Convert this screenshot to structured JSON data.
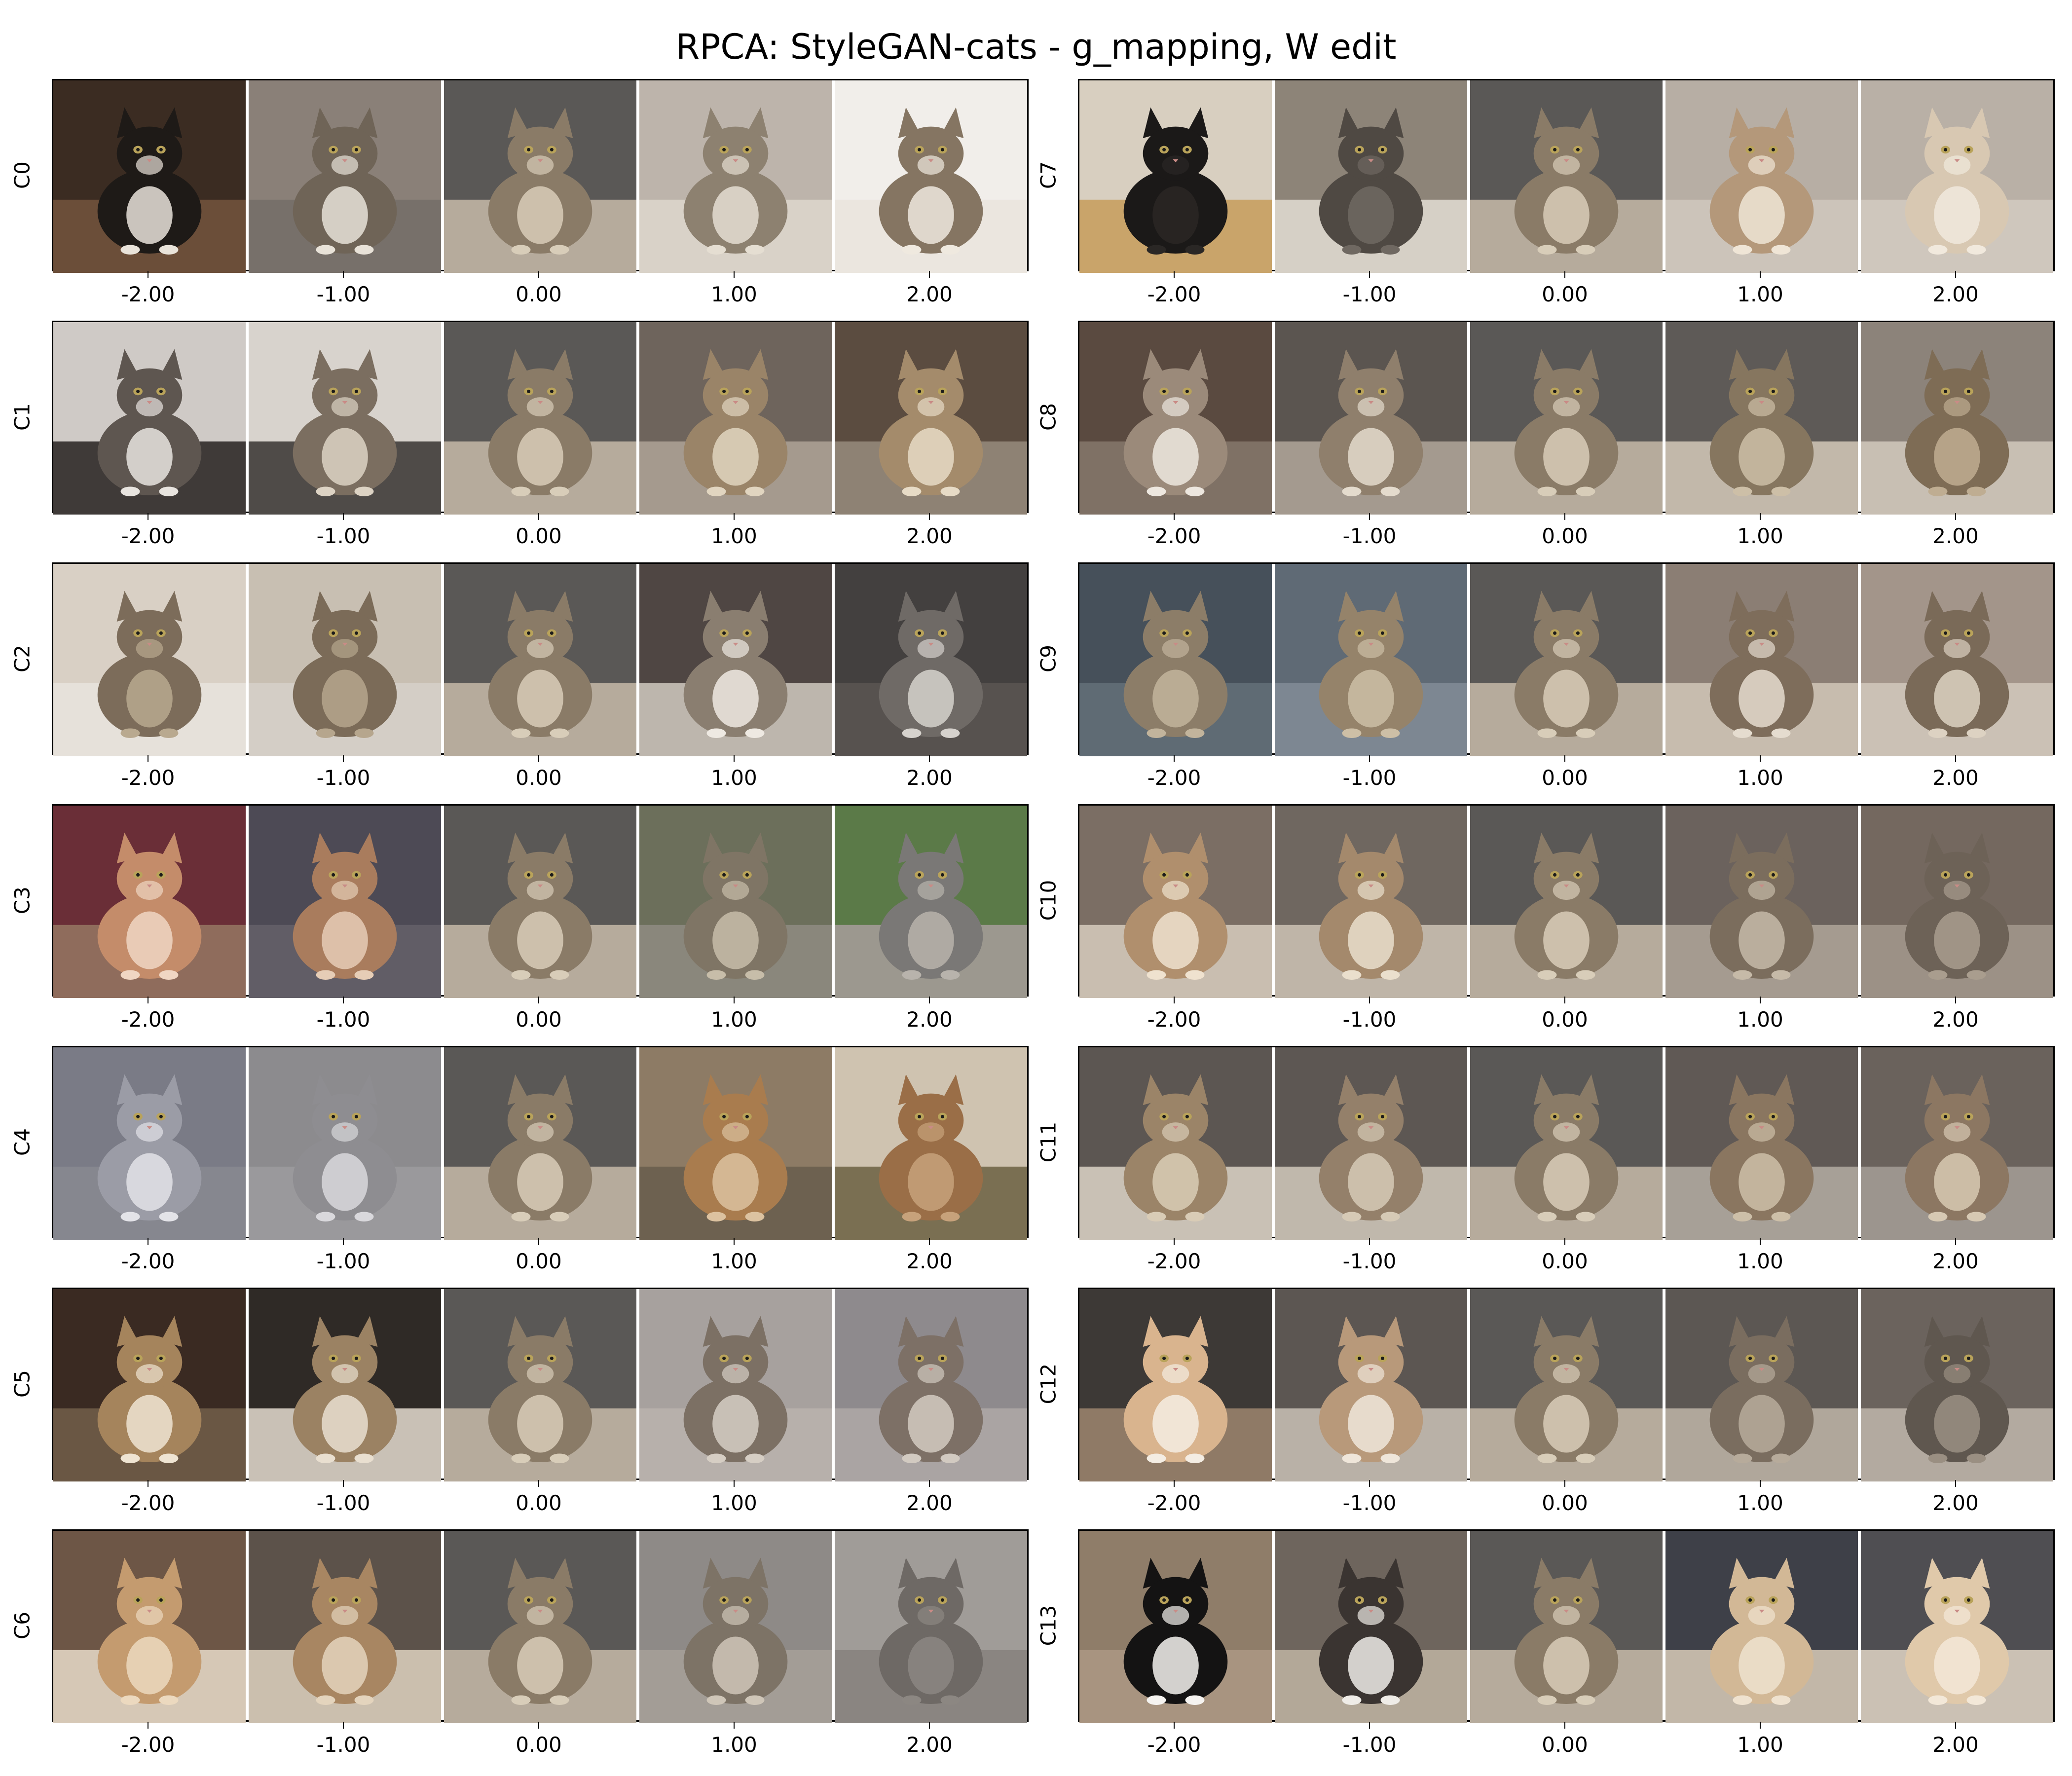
{
  "title": "RPCA: StyleGAN-cats - g_mapping, W edit",
  "x_ticks": [
    "-2.00",
    "-1.00",
    "0.00",
    "1.00",
    "2.00"
  ],
  "columns": [
    {
      "rows": [
        {
          "label": "C0",
          "images": [
            {
              "bg": "#3b2c22",
              "cat": "#1e1a17",
              "belly": "#e9e3da",
              "floor": "#6b4e39"
            },
            {
              "bg": "#8a8078",
              "cat": "#6f6457",
              "belly": "#e8e2d8",
              "floor": "#77706a"
            },
            {
              "bg": "#5a5856",
              "cat": "#8a7b67",
              "belly": "#d8cdb9",
              "floor": "#b6ab9c"
            },
            {
              "bg": "#bdb4ab",
              "cat": "#8d8170",
              "belly": "#e5ded2",
              "floor": "#d9d2c8"
            },
            {
              "bg": "#f1eeea",
              "cat": "#857562",
              "belly": "#efe9df",
              "floor": "#ebe6df"
            }
          ]
        },
        {
          "label": "C1",
          "images": [
            {
              "bg": "#cfcac6",
              "cat": "#5e5650",
              "belly": "#e8e4df",
              "floor": "#3f3a38"
            },
            {
              "bg": "#d8d3cd",
              "cat": "#7b6e60",
              "belly": "#ddd3c4",
              "floor": "#4f4b48"
            },
            {
              "bg": "#5a5856",
              "cat": "#8a7b67",
              "belly": "#d8cdb9",
              "floor": "#b6ab9c"
            },
            {
              "bg": "#6e645c",
              "cat": "#9a8468",
              "belly": "#e1d5c0",
              "floor": "#a59a8e"
            },
            {
              "bg": "#5b4c40",
              "cat": "#a48b6b",
              "belly": "#e7dbc6",
              "floor": "#8e8274"
            }
          ]
        },
        {
          "label": "C2",
          "images": [
            {
              "bg": "#d9d0c5",
              "cat": "#7c6c5a",
              "belly": "#b9a98f",
              "floor": "#e6e1da"
            },
            {
              "bg": "#c8bfb2",
              "cat": "#7b6b58",
              "belly": "#b6a68d",
              "floor": "#d4cec6"
            },
            {
              "bg": "#5a5856",
              "cat": "#8a7b67",
              "belly": "#d8cdb9",
              "floor": "#b6ab9c"
            },
            {
              "bg": "#4f4643",
              "cat": "#8a7e70",
              "belly": "#eee9e2",
              "floor": "#bdb6ad"
            },
            {
              "bg": "#43403f",
              "cat": "#6f6a66",
              "belly": "#d6d2cd",
              "floor": "#57524f"
            }
          ]
        },
        {
          "label": "C3",
          "images": [
            {
              "bg": "#6a2e37",
              "cat": "#c48c6a",
              "belly": "#f0d6c3",
              "floor": "#8f6c5c"
            },
            {
              "bg": "#4d4a55",
              "cat": "#a97c5d",
              "belly": "#e6cdb6",
              "floor": "#615d66"
            },
            {
              "bg": "#5a5856",
              "cat": "#8a7b67",
              "belly": "#d8cdb9",
              "floor": "#b6ab9c"
            },
            {
              "bg": "#6c6f5b",
              "cat": "#7f7565",
              "belly": "#c7bda9",
              "floor": "#8a877c"
            },
            {
              "bg": "#5b7a48",
              "cat": "#7a7876",
              "belly": "#b8b3ac",
              "floor": "#9c988f"
            }
          ]
        },
        {
          "label": "C4",
          "images": [
            {
              "bg": "#7a7b86",
              "cat": "#9b9ca6",
              "belly": "#e3e3e8",
              "floor": "#86878f"
            },
            {
              "bg": "#8c8b8e",
              "cat": "#8e8d91",
              "belly": "#d9d8dc",
              "floor": "#9a999c"
            },
            {
              "bg": "#5a5856",
              "cat": "#8a7b67",
              "belly": "#d8cdb9",
              "floor": "#b6ab9c"
            },
            {
              "bg": "#8d7b65",
              "cat": "#a97c4e",
              "belly": "#dcc2a0",
              "floor": "#6d6150"
            },
            {
              "bg": "#cfc3b0",
              "cat": "#9a6e47",
              "belly": "#c7a27b",
              "floor": "#7a6f52"
            }
          ]
        },
        {
          "label": "C5",
          "images": [
            {
              "bg": "#3a2a22",
              "cat": "#a5845c",
              "belly": "#efe4d2",
              "floor": "#6a5744"
            },
            {
              "bg": "#2f2a26",
              "cat": "#9b8263",
              "belly": "#e9dfd0",
              "floor": "#c9c1b6"
            },
            {
              "bg": "#5a5856",
              "cat": "#8a7b67",
              "belly": "#d8cdb9",
              "floor": "#b6ab9c"
            },
            {
              "bg": "#a7a19e",
              "cat": "#7c7064",
              "belly": "#d6cec4",
              "floor": "#b7b0ab"
            },
            {
              "bg": "#8e8a8d",
              "cat": "#7d7066",
              "belly": "#d2cac1",
              "floor": "#aaa4a3"
            }
          ]
        },
        {
          "label": "C6",
          "images": [
            {
              "bg": "#6d5646",
              "cat": "#c49b6f",
              "belly": "#ecd9bf",
              "floor": "#d6c8b6"
            },
            {
              "bg": "#5c524a",
              "cat": "#a88662",
              "belly": "#e4d4bd",
              "floor": "#cbbfae"
            },
            {
              "bg": "#5a5856",
              "cat": "#8a7b67",
              "belly": "#d8cdb9",
              "floor": "#b6ab9c"
            },
            {
              "bg": "#8e8a87",
              "cat": "#7d7366",
              "belly": "#cfc6b8",
              "floor": "#a39d96"
            },
            {
              "bg": "#a09c98",
              "cat": "#6e6965",
              "belly": "#8c8782",
              "floor": "#8a8581"
            }
          ]
        }
      ]
    },
    {
      "rows": [
        {
          "label": "C7",
          "images": [
            {
              "bg": "#d8cfc0",
              "cat": "#1b1918",
              "belly": "#2a2725",
              "floor": "#c9a46a"
            },
            {
              "bg": "#8d8478",
              "cat": "#4f4943",
              "belly": "#6f6861",
              "floor": "#d6d0c6"
            },
            {
              "bg": "#5a5856",
              "cat": "#8a7b67",
              "belly": "#d8cdb9",
              "floor": "#b6ab9c"
            },
            {
              "bg": "#b7aea4",
              "cat": "#b4987a",
              "belly": "#efe5d6",
              "floor": "#ccc4ba"
            },
            {
              "bg": "#b9b0a6",
              "cat": "#d8c8b2",
              "belly": "#f1e9dd",
              "floor": "#cfc7bd"
            }
          ]
        },
        {
          "label": "C8",
          "images": [
            {
              "bg": "#5a4a40",
              "cat": "#9b8a7a",
              "belly": "#ede7df",
              "floor": "#7f7165"
            },
            {
              "bg": "#5b5550",
              "cat": "#8f7f6c",
              "belly": "#e4dbcd",
              "floor": "#a49a8f"
            },
            {
              "bg": "#5a5856",
              "cat": "#8a7b67",
              "belly": "#d8cdb9",
              "floor": "#b6ab9c"
            },
            {
              "bg": "#5e5a57",
              "cat": "#86765f",
              "belly": "#cdbfa7",
              "floor": "#c2b8aa"
            },
            {
              "bg": "#8c837a",
              "cat": "#7e6c55",
              "belly": "#bfad92",
              "floor": "#c8bfb3"
            }
          ]
        },
        {
          "label": "C9",
          "images": [
            {
              "bg": "#46505a",
              "cat": "#8c7d68",
              "belly": "#c2b49c",
              "floor": "#5f6b74"
            },
            {
              "bg": "#5f6a75",
              "cat": "#95836a",
              "belly": "#cdbfa6",
              "floor": "#7d8792"
            },
            {
              "bg": "#5a5856",
              "cat": "#8a7b67",
              "belly": "#d8cdb9",
              "floor": "#b6ab9c"
            },
            {
              "bg": "#8b7e74",
              "cat": "#7e6d5b",
              "belly": "#e5dccf",
              "floor": "#c7bcae"
            },
            {
              "bg": "#a3958a",
              "cat": "#7a6a58",
              "belly": "#ddd2c2",
              "floor": "#cbc1b5"
            }
          ]
        },
        {
          "label": "C10",
          "images": [
            {
              "bg": "#7b6e64",
              "cat": "#b08f6d",
              "belly": "#efe2cf",
              "floor": "#c9beb0"
            },
            {
              "bg": "#6f6760",
              "cat": "#a4896c",
              "belly": "#eadfcd",
              "floor": "#bfb5a8"
            },
            {
              "bg": "#5a5856",
              "cat": "#8a7b67",
              "belly": "#d8cdb9",
              "floor": "#b6ab9c"
            },
            {
              "bg": "#6b625d",
              "cat": "#7b6d5d",
              "belly": "#c6baa8",
              "floor": "#a59b90"
            },
            {
              "bg": "#74685f",
              "cat": "#6d6257",
              "belly": "#a99d8e",
              "floor": "#9c9186"
            }
          ]
        },
        {
          "label": "C11",
          "images": [
            {
              "bg": "#5c5652",
              "cat": "#9b8468",
              "belly": "#d9ccb6",
              "floor": "#c9c1b5"
            },
            {
              "bg": "#5d5753",
              "cat": "#94806a",
              "belly": "#d6cab6",
              "floor": "#c0b8ac"
            },
            {
              "bg": "#5a5856",
              "cat": "#8a7b67",
              "belly": "#d8cdb9",
              "floor": "#b6ab9c"
            },
            {
              "bg": "#605955",
              "cat": "#8a7660",
              "belly": "#cdbfa8",
              "floor": "#a7a097"
            },
            {
              "bg": "#6a625c",
              "cat": "#8c7762",
              "belly": "#d7c9b3",
              "floor": "#9c958e"
            }
          ]
        },
        {
          "label": "C12",
          "images": [
            {
              "bg": "#3d3936",
              "cat": "#d9b48e",
              "belly": "#f4ede3",
              "floor": "#8f7a66"
            },
            {
              "bg": "#5c5652",
              "cat": "#b8997a",
              "belly": "#efe6da",
              "floor": "#b9b1a7"
            },
            {
              "bg": "#5a5856",
              "cat": "#8a7b67",
              "belly": "#d8cdb9",
              "floor": "#b6ab9c"
            },
            {
              "bg": "#5c5753",
              "cat": "#7a6d5f",
              "belly": "#b7ab9b",
              "floor": "#b0a79b"
            },
            {
              "bg": "#6b635d",
              "cat": "#5f574f",
              "belly": "#9a8f82",
              "floor": "#b3aaa0"
            }
          ]
        },
        {
          "label": "C13",
          "images": [
            {
              "bg": "#8f7d69",
              "cat": "#141313",
              "belly": "#f5f3f0",
              "floor": "#a89480"
            },
            {
              "bg": "#6e655d",
              "cat": "#3a3431",
              "belly": "#efece7",
              "floor": "#b3a898"
            },
            {
              "bg": "#5a5856",
              "cat": "#8a7b67",
              "belly": "#d8cdb9",
              "floor": "#b6ab9c"
            },
            {
              "bg": "#3e4048",
              "cat": "#d2b896",
              "belly": "#efe2cf",
              "floor": "#c2b7a8"
            },
            {
              "bg": "#4f4e52",
              "cat": "#e0c9aa",
              "belly": "#f3e8d8",
              "floor": "#cbc1b4"
            }
          ]
        }
      ]
    }
  ]
}
